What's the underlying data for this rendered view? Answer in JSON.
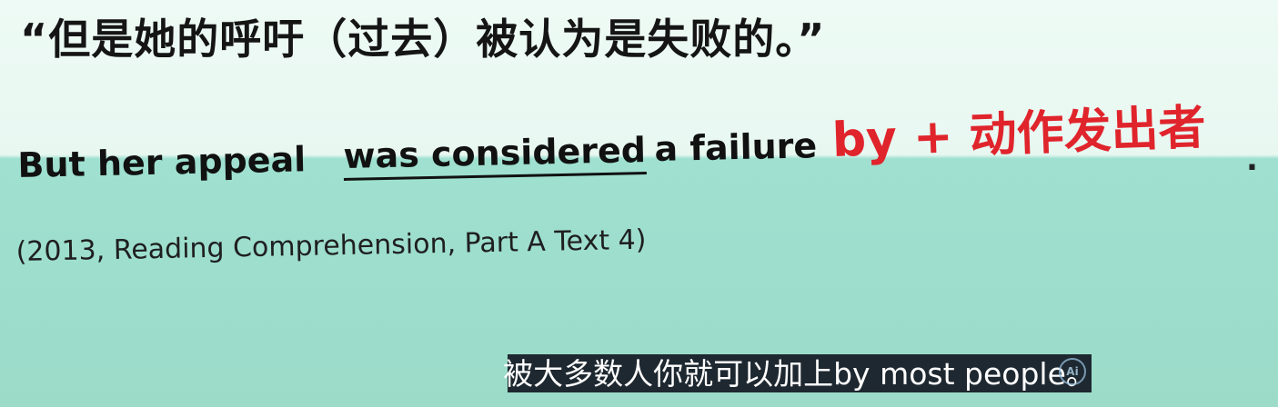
{
  "slide": {
    "quote_line": "“但是她的呼吁（过去）被认为是失败的。”",
    "sentence": {
      "part1": "But her appeal",
      "underlined": "was considered",
      "part2": "a failure",
      "emphasis": "by + 动作发出者",
      "ending": "."
    },
    "source": "(2013, Reading Comprehension, Part A Text 4)"
  },
  "subtitle": {
    "text": "被大多数人你就可以加上by most people。"
  },
  "colors": {
    "emphasis": "#e0242c",
    "top_background": "#eefaf5",
    "bottom_background": "#9fe0d0"
  },
  "icons": {
    "watermark": "video-watermark-icon"
  }
}
